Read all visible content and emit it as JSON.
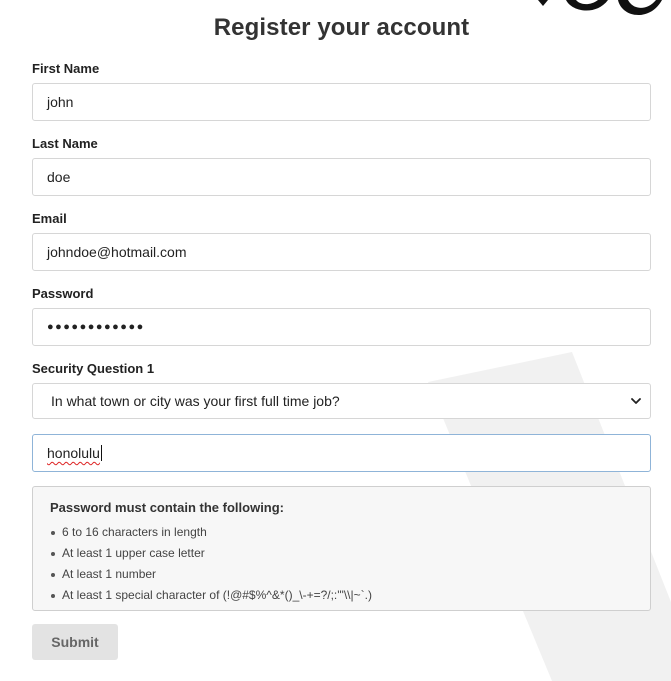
{
  "form": {
    "title": "Register your account",
    "first_name": {
      "label": "First Name",
      "value": "john"
    },
    "last_name": {
      "label": "Last Name",
      "value": "doe"
    },
    "email": {
      "label": "Email",
      "value": "johndoe@hotmail.com"
    },
    "password": {
      "label": "Password",
      "value": "●●●●●●●●●●●●"
    },
    "security_question_1": {
      "label": "Security Question 1",
      "selected": "In what town or city was your first full time job?",
      "answer": "honolulu"
    },
    "password_rules": {
      "title": "Password must contain the following:",
      "items": [
        "6 to 16 characters in length",
        "At least 1 upper case letter",
        "At least 1 number",
        "At least 1 special character of (!@#$%^&*()_\\-+=?/;:'\"\\\\|~`.)"
      ]
    },
    "submit_label": "Submit"
  },
  "icons": {
    "dropdown": "chevron-down-icon",
    "list_bullet": "bullet-icon"
  },
  "colors": {
    "focus_border": "#8fb4d8",
    "button_bg": "#e3e3e3",
    "rules_bg": "#f7f7f7"
  }
}
